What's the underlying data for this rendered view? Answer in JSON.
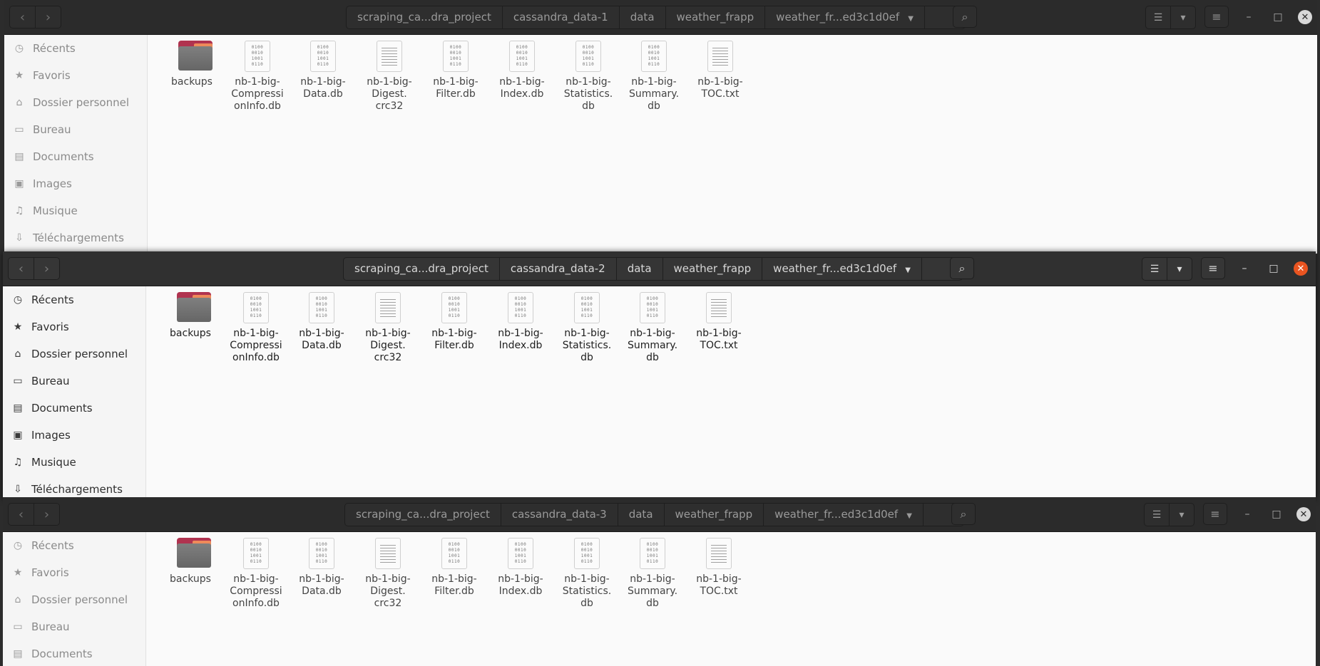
{
  "windows": [
    {
      "path": [
        "scraping_ca...dra_project",
        "cassandra_data-1",
        "data",
        "weather_frapp",
        "weather_fr...ed3c1d0ef"
      ],
      "active": false
    },
    {
      "path": [
        "scraping_ca...dra_project",
        "cassandra_data-2",
        "data",
        "weather_frapp",
        "weather_fr...ed3c1d0ef"
      ],
      "active": true
    },
    {
      "path": [
        "scraping_ca...dra_project",
        "cassandra_data-3",
        "data",
        "weather_frapp",
        "weather_fr...ed3c1d0ef"
      ],
      "active": false
    }
  ],
  "sidebar": [
    {
      "label": "Récents",
      "icon": "clock-icon"
    },
    {
      "label": "Favoris",
      "icon": "star-icon"
    },
    {
      "label": "Dossier personnel",
      "icon": "home-icon"
    },
    {
      "label": "Bureau",
      "icon": "desktop-icon"
    },
    {
      "label": "Documents",
      "icon": "document-icon"
    },
    {
      "label": "Images",
      "icon": "image-icon"
    },
    {
      "label": "Musique",
      "icon": "music-icon"
    },
    {
      "label": "Téléchargements",
      "icon": "download-icon"
    }
  ],
  "files": [
    {
      "name": "backups",
      "type": "folder"
    },
    {
      "name": "nb-1-big-CompressionInfo.db",
      "type": "binary"
    },
    {
      "name": "nb-1-big-Data.db",
      "type": "binary"
    },
    {
      "name": "nb-1-big-Digest.crc32",
      "type": "text"
    },
    {
      "name": "nb-1-big-Filter.db",
      "type": "binary"
    },
    {
      "name": "nb-1-big-Index.db",
      "type": "binary"
    },
    {
      "name": "nb-1-big-Statistics.db",
      "type": "binary"
    },
    {
      "name": "nb-1-big-Summary.db",
      "type": "binary"
    },
    {
      "name": "nb-1-big-TOC.txt",
      "type": "text"
    }
  ],
  "binary_glyph": [
    "0100",
    "0010",
    "1001",
    "0110"
  ],
  "colors": {
    "accent_close": "#e95420",
    "folder_tab": "#b0334f",
    "folder_body": "#777777"
  }
}
